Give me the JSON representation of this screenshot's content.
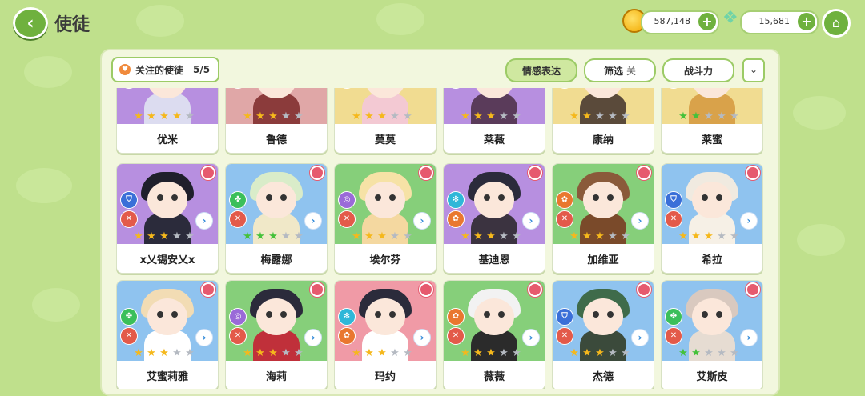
{
  "header": {
    "title": "使徒",
    "coins": "587,148",
    "gems": "15,681"
  },
  "panel": {
    "favorites_label": "关注的使徒",
    "favorites_count": "5/5",
    "btn_emotion": "情感表达",
    "btn_filter": "筛选",
    "filter_state": "关",
    "btn_power": "战斗力"
  },
  "characters": [
    {
      "name": "优米",
      "bg": "#b78fe0",
      "hair": "#eeeeee",
      "body": "#dcdcf0",
      "stars": 4,
      "star_color": "gold"
    },
    {
      "name": "鲁德",
      "bg": "#e0a7a7",
      "hair": "#7a2f2f",
      "body": "#8b3b3b",
      "stars": 3,
      "star_color": "gold"
    },
    {
      "name": "莫莫",
      "bg": "#f1dc91",
      "hair": "#f3e1d2",
      "body": "#f3c9d3",
      "stars": 3,
      "star_color": "gold"
    },
    {
      "name": "莱薇",
      "bg": "#b78fe0",
      "hair": "#3b2b3b",
      "body": "#5a3b5a",
      "stars": 3,
      "star_color": "gold"
    },
    {
      "name": "康纳",
      "bg": "#f1dc91",
      "hair": "#e7d2a3",
      "body": "#5a4a3a",
      "stars": 2,
      "star_color": "gold"
    },
    {
      "name": "莱蜜",
      "bg": "#f1dc91",
      "hair": "#b9863e",
      "body": "#d9a24a",
      "stars": 2,
      "star_color": "green"
    },
    {
      "name": "ⅹ乂锡安乂ⅹ",
      "bg": "#b78fe0",
      "hair": "#1f1f2b",
      "body": "#2b2b3b",
      "stars": 3,
      "star_color": "gold"
    },
    {
      "name": "梅露娜",
      "bg": "#8fc3ef",
      "hair": "#d9ecc9",
      "body": "#f0e8c8",
      "stars": 3,
      "star_color": "green"
    },
    {
      "name": "埃尔芬",
      "bg": "#86cf7a",
      "hair": "#f6e2a6",
      "body": "#f4d8a0",
      "stars": 3,
      "star_color": "gold"
    },
    {
      "name": "基迪恩",
      "bg": "#b78fe0",
      "hair": "#2b2b3b",
      "body": "#3b3340",
      "stars": 3,
      "star_color": "gold"
    },
    {
      "name": "加维亚",
      "bg": "#86cf7a",
      "hair": "#8a5a3a",
      "body": "#7a4a2a",
      "stars": 3,
      "star_color": "gold"
    },
    {
      "name": "希拉",
      "bg": "#8fc3ef",
      "hair": "#f0eae0",
      "body": "#f6f0e6",
      "stars": 3,
      "star_color": "gold"
    },
    {
      "name": "艾蜜莉雅",
      "bg": "#8fc3ef",
      "hair": "#f2dcb4",
      "body": "#ffffff",
      "stars": 3,
      "star_color": "gold"
    },
    {
      "name": "海莉",
      "bg": "#86cf7a",
      "hair": "#2b2b3b",
      "body": "#c0303a",
      "stars": 3,
      "star_color": "gold"
    },
    {
      "name": "玛约",
      "bg": "#f09aa6",
      "hair": "#2b2b3b",
      "body": "#ffffff",
      "stars": 3,
      "star_color": "gold"
    },
    {
      "name": "薇薇",
      "bg": "#86cf7a",
      "hair": "#f2f2f2",
      "body": "#2b2b2b",
      "stars": 3,
      "star_color": "gold"
    },
    {
      "name": "杰德",
      "bg": "#8fc3ef",
      "hair": "#3f6b4a",
      "body": "#3b4a3b",
      "stars": 3,
      "star_color": "gold"
    },
    {
      "name": "艾斯皮",
      "bg": "#8fc3ef",
      "hair": "#d9c9bf",
      "body": "#e6dcd2",
      "stars": 2,
      "star_color": "green"
    }
  ],
  "colors": {
    "accent_green": "#6fb13e",
    "gold_star": "#f5b81c",
    "green_star": "#45c13a",
    "gray_star": "#b5bac2"
  }
}
